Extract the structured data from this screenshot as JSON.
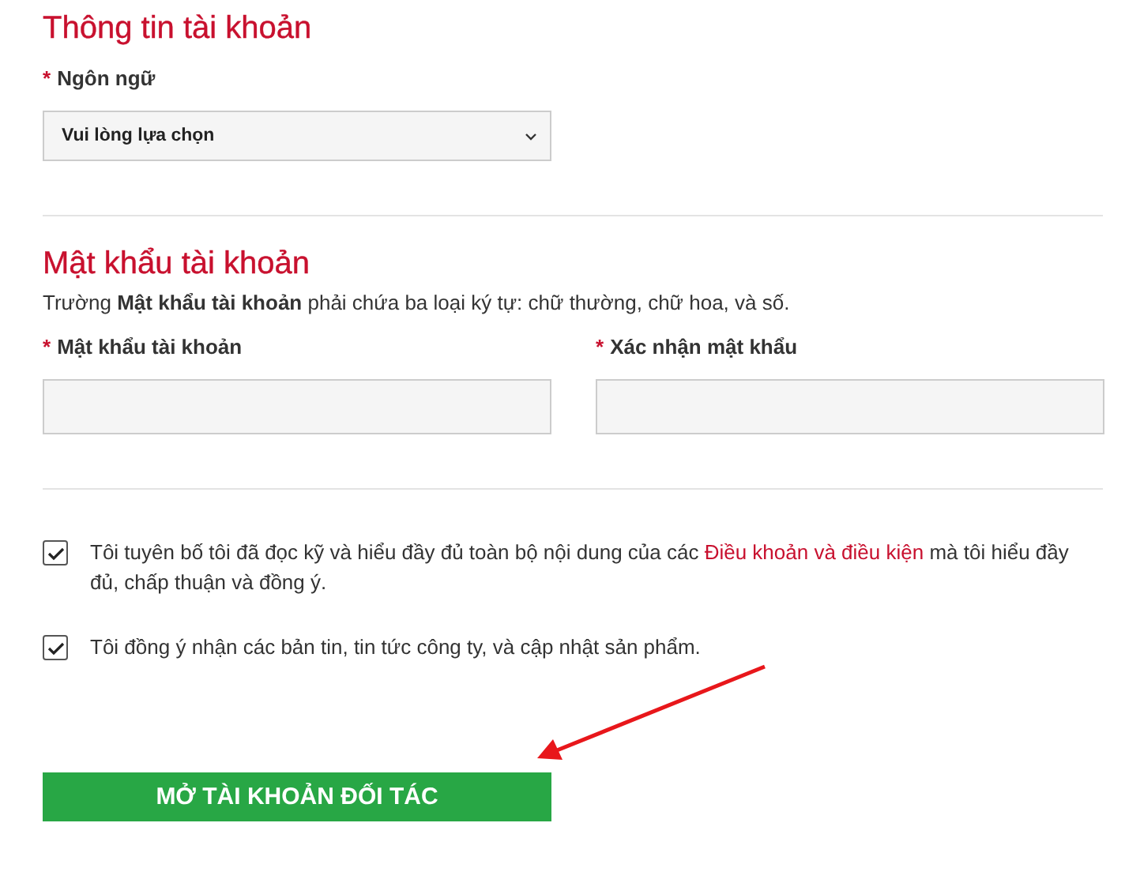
{
  "account_info": {
    "title": "Thông tin tài khoản",
    "language": {
      "required_mark": "*",
      "label": "Ngôn ngữ",
      "value": "Vui lòng lựa chọn"
    }
  },
  "password": {
    "title": "Mật khẩu tài khoản",
    "hint": "Trường **Mật khẩu tài khoản** phải chứa ba loại ký tự: chữ thường, chữ hoa, và số.",
    "fields": [
      {
        "required_mark": "*",
        "label": "Mật khẩu tài khoản"
      },
      {
        "required_mark": "*",
        "label": "Xác nhận mật khẩu"
      }
    ]
  },
  "agreements": [
    {
      "checked": true,
      "text_before": "Tôi tuyên bố tôi đã đọc kỹ và hiểu đầy đủ toàn bộ nội dung của các ",
      "link": "Điều khoản và điều kiện",
      "text_after": " mà tôi hiểu đầy đủ, chấp thuận và đồng ý."
    },
    {
      "checked": true,
      "text_before": "Tôi đồng ý nhận các bản tin, tin tức công ty, và cập nhật sản phẩm."
    }
  ],
  "submit_button": "MỞ TÀI KHOẢN ĐỐI TÁC"
}
